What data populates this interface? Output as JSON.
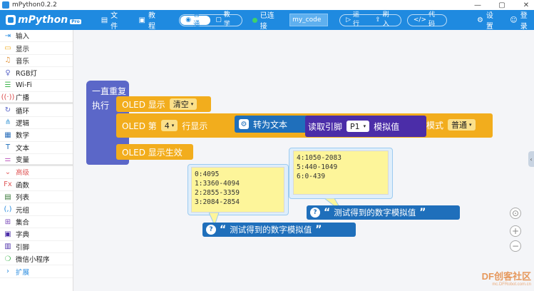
{
  "window": {
    "title": "mPython0.2.2",
    "controls": [
      "—",
      "▢",
      "✕"
    ]
  },
  "menubar": {
    "logo_text": "mPython",
    "logo_badge": "Pro",
    "file_label": "文件",
    "tutorial_label": "教程",
    "mode_normal": "普通",
    "mode_teach": "教学",
    "connection_status": "已连接",
    "port_value": "my_code",
    "run_label": "运行",
    "flash_label": "刷入",
    "code_label": "代码",
    "settings_label": "设置",
    "login_label": "登录"
  },
  "sidebar": {
    "items": [
      {
        "label": "输入",
        "icon": "input-icon",
        "color": "#2b8de0"
      },
      {
        "label": "显示",
        "icon": "display-icon",
        "color": "#f2ad1d"
      },
      {
        "label": "音乐",
        "icon": "music-icon",
        "color": "#e0923a"
      },
      {
        "label": "RGB灯",
        "icon": "rgb-light-icon",
        "color": "#5b67c8"
      },
      {
        "label": "Wi-Fi",
        "icon": "wifi-icon",
        "color": "#3cb44b"
      },
      {
        "label": "广播",
        "icon": "broadcast-icon",
        "color": "#d94a4a"
      },
      {
        "label": "循环",
        "icon": "loop-icon",
        "color": "#5b67c8"
      },
      {
        "label": "逻辑",
        "icon": "logic-icon",
        "color": "#3f9ad6"
      },
      {
        "label": "数学",
        "icon": "math-icon",
        "color": "#2b6fbb"
      },
      {
        "label": "文本",
        "icon": "text-icon",
        "color": "#1f6fbb"
      },
      {
        "label": "变量",
        "icon": "variable-icon",
        "color": "#c05fc0"
      },
      {
        "label": "高级",
        "icon": "advanced-icon",
        "color": "#e05a5a"
      },
      {
        "label": "函数",
        "icon": "function-icon",
        "color": "#e05a5a"
      },
      {
        "label": "列表",
        "icon": "list-icon",
        "color": "#3a7a3a"
      },
      {
        "label": "元组",
        "icon": "tuple-icon",
        "color": "#2b8de0"
      },
      {
        "label": "集合",
        "icon": "set-icon",
        "color": "#7a4ab8"
      },
      {
        "label": "字典",
        "icon": "dict-icon",
        "color": "#4b2da8"
      },
      {
        "label": "引脚",
        "icon": "pin-icon",
        "color": "#4b2da8"
      },
      {
        "label": "微信小程序",
        "icon": "wechat-icon",
        "color": "#3cb44b"
      },
      {
        "label": "扩展",
        "icon": "chevron-right-icon",
        "color": "#2b8de0"
      }
    ]
  },
  "blocks": {
    "forever": "一直重复",
    "do": "执行",
    "oled_clear_prefix": "OLED 显示",
    "oled_clear_option": "清空",
    "oled_line_prefix": "OLED 第",
    "oled_line_number": "4",
    "oled_line_suffix": "行显示",
    "to_text": "转为文本",
    "read_pin": "读取引脚",
    "pin_value": "P1",
    "analog": "模拟值",
    "mode_label": "模式",
    "mode_value": "普通",
    "oled_show": "OLED 显示生效"
  },
  "comments": {
    "left": "0:4095\n1:3360-4094\n2:2855-3359\n3:2084-2854",
    "right": "4:1050-2083\n5:440-1049\n6:0-439"
  },
  "string_blocks": {
    "text": "测试得到的数字模拟值",
    "open_quote": "“",
    "close_quote": "”"
  },
  "zoom": {
    "center": "⊙",
    "plus": "+",
    "minus": "−"
  },
  "watermark": {
    "main": "DF创客社区",
    "sub": "mc.DFRobot.com.cn"
  }
}
